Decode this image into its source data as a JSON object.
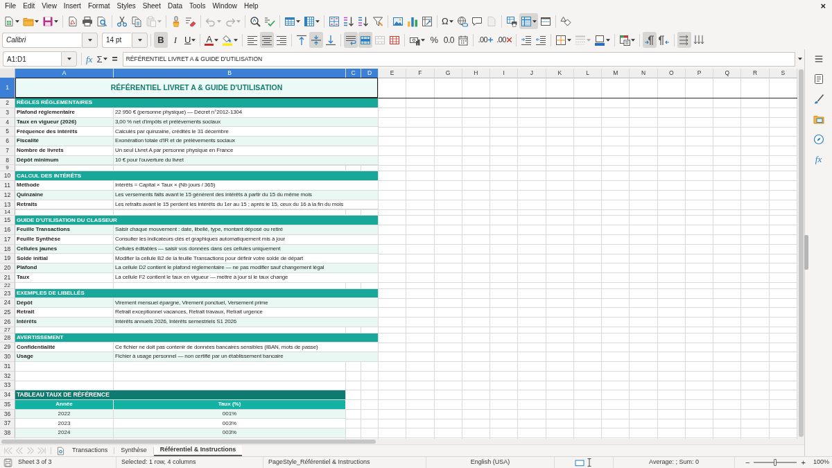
{
  "menu": [
    "File",
    "Edit",
    "View",
    "Insert",
    "Format",
    "Styles",
    "Sheet",
    "Data",
    "Tools",
    "Window",
    "Help"
  ],
  "document_close": "×",
  "standard_toolbar": {
    "paste_disabled": true,
    "undo_disabled": true,
    "redo_disabled": true,
    "header_footer_disabled": true,
    "freeze_on": true,
    "special_character": "Ω"
  },
  "format_toolbar": {
    "font_name": "Calibri",
    "font_size": "14 pt",
    "bold": "B",
    "italic": "I",
    "underline": "U",
    "font_color": "A",
    "percent": "%",
    "number_format": "0.0",
    "add_decimal": ".00",
    "delete_decimal": ".00",
    "bold_on": true,
    "italic_on": false,
    "underline_on": false,
    "align_left_on": false,
    "align_center_on": true,
    "align_right_on": false,
    "align_top_on": false,
    "align_middle_on": true,
    "align_bottom_on": false,
    "wrap_text_on": true,
    "merge_center_on": true,
    "merge_cells_disabled": true,
    "border_style_disabled": true,
    "left_to_right_on": true,
    "right_to_left_on": false,
    "text_horizontal_on": true,
    "text_vertical_on": false
  },
  "formula_bar": {
    "name_box": "A1:D1",
    "function_wizard": "fx",
    "sum": "Σ",
    "equals": "=",
    "formula": "RÉFÉRENTIEL LIVRET A & GUIDE D'UTILISATION"
  },
  "columns": [
    {
      "label": "A",
      "selected": true
    },
    {
      "label": "B",
      "selected": true
    },
    {
      "label": "C",
      "selected": true
    },
    {
      "label": "D",
      "selected": true
    },
    {
      "label": "E",
      "selected": false
    },
    {
      "label": "F",
      "selected": false
    },
    {
      "label": "G",
      "selected": false
    },
    {
      "label": "H",
      "selected": false
    },
    {
      "label": "I",
      "selected": false
    },
    {
      "label": "J",
      "selected": false
    },
    {
      "label": "K",
      "selected": false
    },
    {
      "label": "L",
      "selected": false
    },
    {
      "label": "M",
      "selected": false
    },
    {
      "label": "N",
      "selected": false
    },
    {
      "label": "O",
      "selected": false
    },
    {
      "label": "P",
      "selected": false
    },
    {
      "label": "Q",
      "selected": false
    },
    {
      "label": "R",
      "selected": false
    },
    {
      "label": "S",
      "selected": false
    }
  ],
  "rows": [
    {
      "number": "1",
      "selected": true,
      "kind": "title",
      "cells": [
        "RÉFÉRENTIEL LIVRET A & GUIDE D'UTILISATION"
      ]
    },
    {
      "number": "2",
      "selected": false,
      "kind": "section",
      "cells": [
        "RÈGLES RÉGLEMENTAIRES"
      ]
    },
    {
      "number": "3",
      "selected": false,
      "kind": "item",
      "shaded": false,
      "cells": [
        "Plafond réglementaire",
        "22 950 € (personne physique) — Décret n°2012-1304"
      ]
    },
    {
      "number": "4",
      "selected": false,
      "kind": "item",
      "shaded": true,
      "cells": [
        "Taux en vigueur (2026)",
        "3,00 % net d'impôts et prélèvements sociaux"
      ]
    },
    {
      "number": "5",
      "selected": false,
      "kind": "item",
      "shaded": false,
      "cells": [
        "Fréquence des intérêts",
        "Calculés par quinzaine, crédités le 31 décembre"
      ]
    },
    {
      "number": "6",
      "selected": false,
      "kind": "item",
      "shaded": true,
      "cells": [
        "Fiscalité",
        "Exonération totale d'IR et de prélèvements sociaux"
      ]
    },
    {
      "number": "7",
      "selected": false,
      "kind": "item",
      "shaded": false,
      "cells": [
        "Nombre de livrets",
        "Un seul Livret A par personne physique en France"
      ]
    },
    {
      "number": "8",
      "selected": false,
      "kind": "item",
      "shaded": true,
      "cells": [
        "Dépôt minimum",
        "10 € pour l'ouverture du livret"
      ]
    },
    {
      "number": "9",
      "selected": false,
      "kind": "spacer"
    },
    {
      "number": "10",
      "selected": false,
      "kind": "section",
      "cells": [
        "CALCUL DES INTÉRÊTS"
      ]
    },
    {
      "number": "11",
      "selected": false,
      "kind": "item",
      "shaded": false,
      "cells": [
        "Méthode",
        "Intérêts = Capital × Taux × (Nb jours / 365)"
      ]
    },
    {
      "number": "12",
      "selected": false,
      "kind": "item",
      "shaded": true,
      "cells": [
        "Quinzaine",
        "Les versements faits avant le 15 génèrent des intérêts à partir du 15 du même mois"
      ]
    },
    {
      "number": "13",
      "selected": false,
      "kind": "item",
      "shaded": false,
      "cells": [
        "Retraits",
        "Les retraits avant le 15 perdent les intérêts du 1er au 15 ; après le 15, ceux du 16 à la fin du mois"
      ]
    },
    {
      "number": "14",
      "selected": false,
      "kind": "spacer"
    },
    {
      "number": "15",
      "selected": false,
      "kind": "section",
      "cells": [
        "GUIDE D'UTILISATION DU CLASSEUR"
      ]
    },
    {
      "number": "16",
      "selected": false,
      "kind": "item",
      "shaded": true,
      "cells": [
        "Feuille Transactions",
        "Saisir chaque mouvement : date, libellé, type, montant déposé ou retiré"
      ]
    },
    {
      "number": "17",
      "selected": false,
      "kind": "item",
      "shaded": false,
      "cells": [
        "Feuille Synthèse",
        "Consulter les indicateurs clés et graphiques automatiquement mis à jour"
      ]
    },
    {
      "number": "18",
      "selected": false,
      "kind": "item",
      "shaded": true,
      "cells": [
        "Cellules jaunes",
        "Cellules éditables — saisir vos données dans ces cellules uniquement"
      ]
    },
    {
      "number": "19",
      "selected": false,
      "kind": "item",
      "shaded": false,
      "cells": [
        "Solde initial",
        "Modifier la cellule B2 de la feuille Transactions pour définir votre solde de départ"
      ]
    },
    {
      "number": "20",
      "selected": false,
      "kind": "item",
      "shaded": true,
      "cells": [
        "Plafond",
        "La cellule D2 contient le plafond réglementaire — ne pas modifier sauf changement légal"
      ]
    },
    {
      "number": "21",
      "selected": false,
      "kind": "item",
      "shaded": false,
      "cells": [
        "Taux",
        "La cellule F2 contient le taux en vigueur — mettre à jour si le taux change"
      ]
    },
    {
      "number": "22",
      "selected": false,
      "kind": "spacer"
    },
    {
      "number": "23",
      "selected": false,
      "kind": "section",
      "cells": [
        "EXEMPLES DE LIBELLÉS"
      ]
    },
    {
      "number": "24",
      "selected": false,
      "kind": "item",
      "shaded": true,
      "cells": [
        "Dépôt",
        "Virement mensuel épargne, Virement ponctuel, Versement prime"
      ]
    },
    {
      "number": "25",
      "selected": false,
      "kind": "item",
      "shaded": false,
      "cells": [
        "Retrait",
        "Retrait exceptionnel vacances, Retrait travaux, Retrait urgence"
      ]
    },
    {
      "number": "26",
      "selected": false,
      "kind": "item",
      "shaded": true,
      "cells": [
        "Intérêts",
        "Intérêts annuels 2026, Intérêts semestriels S1 2026"
      ]
    },
    {
      "number": "27",
      "selected": false,
      "kind": "spacer"
    },
    {
      "number": "28",
      "selected": false,
      "kind": "section",
      "cells": [
        "AVERTISSEMENT"
      ]
    },
    {
      "number": "29",
      "selected": false,
      "kind": "item",
      "shaded": false,
      "cells": [
        "Confidentialité",
        "Ce fichier ne doit pas contenir de données bancaires sensibles (IBAN, mots de passe)"
      ]
    },
    {
      "number": "30",
      "selected": false,
      "kind": "item",
      "shaded": true,
      "cells": [
        "Usage",
        "Fichier à usage personnel — non certifié par un établissement bancaire"
      ]
    },
    {
      "number": "31",
      "selected": false,
      "kind": "blank"
    },
    {
      "number": "32",
      "selected": false,
      "kind": "blank"
    },
    {
      "number": "33",
      "selected": false,
      "kind": "blank"
    },
    {
      "number": "34",
      "selected": false,
      "kind": "table_title",
      "cells": [
        "TABLEAU TAUX DE RÉFÉRENCE"
      ]
    },
    {
      "number": "35",
      "selected": false,
      "kind": "table_header",
      "cells": [
        "Année",
        "Taux (%)"
      ]
    },
    {
      "number": "36",
      "selected": false,
      "kind": "table_row",
      "shaded": true,
      "cells": [
        "2022",
        "001%"
      ]
    },
    {
      "number": "37",
      "selected": false,
      "kind": "table_row",
      "shaded": false,
      "cells": [
        "2023",
        "003%"
      ]
    },
    {
      "number": "38",
      "selected": false,
      "kind": "table_row",
      "shaded": true,
      "cells": [
        "2024",
        "003%"
      ]
    }
  ],
  "sheet_navigation_disabled": true,
  "sheet_tabs": [
    {
      "label": "Transactions",
      "selected": false
    },
    {
      "label": "Synthèse",
      "selected": false
    },
    {
      "label": "Référentiel & Instructions",
      "selected": true
    }
  ],
  "status_bar": {
    "sheet": "Sheet 3 of 3",
    "selection": "Selected: 1 row, 4 columns",
    "page_style": "PageStyle_Référentiel & Instructions",
    "language": "English (USA)",
    "statistics": "Average: ; Sum: 0",
    "zoom_out": "−",
    "zoom_slider": {
      "level": 0.5
    },
    "zoom_in": "+",
    "zoom": "100%"
  },
  "sidebar": {
    "functions": "fx"
  }
}
